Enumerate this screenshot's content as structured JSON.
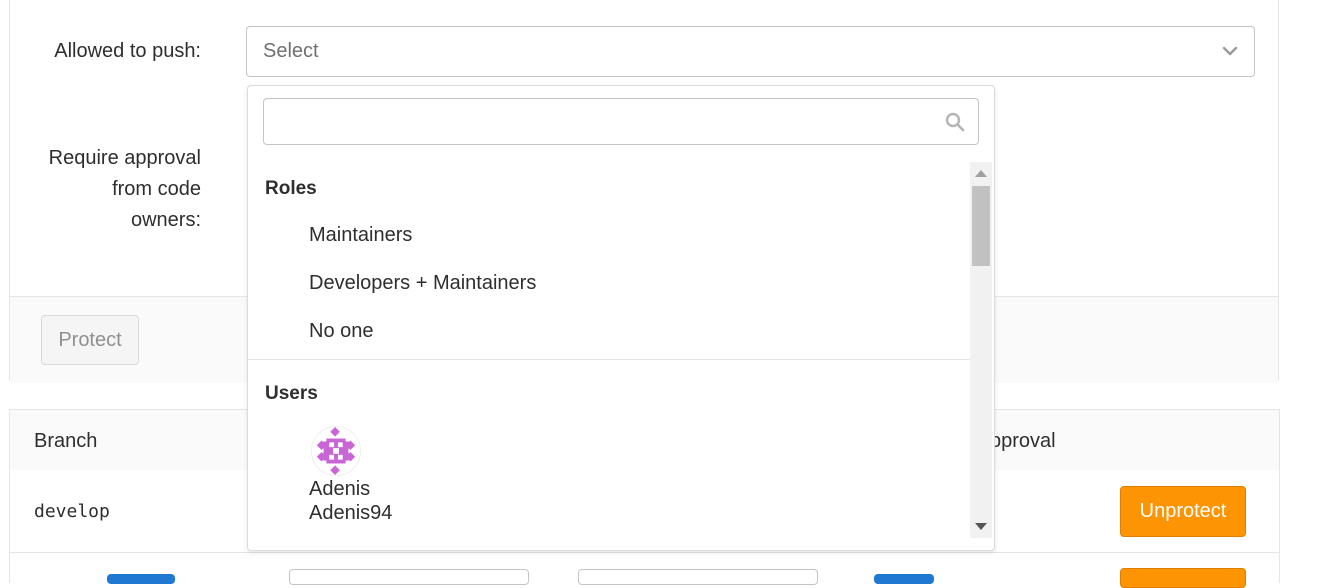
{
  "form": {
    "allowed_to_push_label": "Allowed to push:",
    "allowed_to_push_placeholder": "Select",
    "require_approval_label_line1": "Require approval",
    "require_approval_label_line2": "from code",
    "require_approval_label_line3": "owners:",
    "protect_button": "Protect"
  },
  "table": {
    "headers": {
      "branch": "Branch",
      "approval": "pproval"
    },
    "rows": [
      {
        "branch": "develop",
        "action": "Unprotect"
      }
    ]
  },
  "dropdown": {
    "search_value": "",
    "roles_header": "Roles",
    "roles": [
      "Maintainers",
      "Developers + Maintainers",
      "No one"
    ],
    "users_header": "Users",
    "users": [
      {
        "name": "Adenis",
        "username": "Adenis94",
        "avatar_icon": "identicon-icon"
      }
    ]
  },
  "colors": {
    "unprotect": "#fc9403",
    "avatar": "#c965d4",
    "link_blue": "#1f78d1"
  }
}
